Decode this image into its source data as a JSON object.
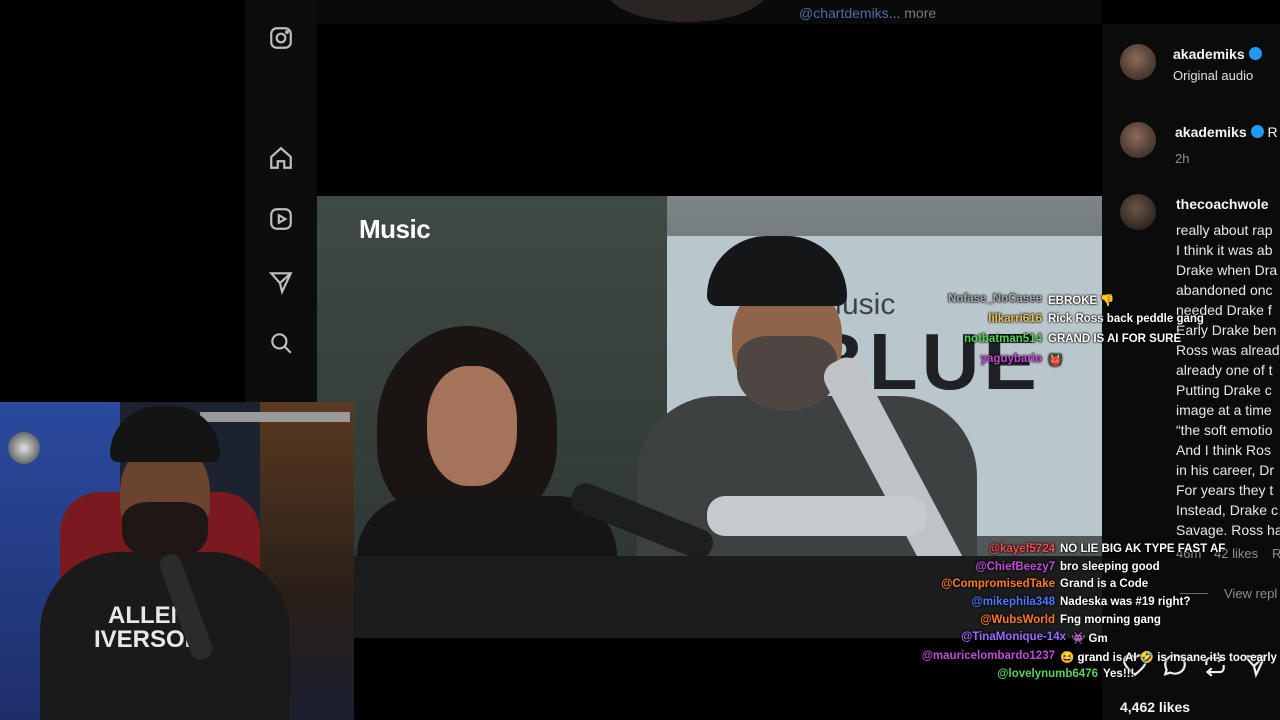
{
  "top_strip": {
    "caption_handle": "@chartdemiks",
    "caption_more": "... more"
  },
  "video": {
    "apple_music_logo": "Music",
    "sign_text": "BLUE",
    "sign_small": "Music"
  },
  "comments_panel": {
    "post_author": "akademiks",
    "post_audio": "Original audio",
    "caption_author": "akademiks",
    "caption_time": "2h",
    "caption_trailing": "R",
    "commenter": "thecoachwole",
    "comment_lines": [
      "really about rap",
      "I think it was ab",
      "Drake when Dra",
      "abandoned onc",
      "needed Drake f",
      "Early Drake ben",
      "Ross was alread",
      "already one of t",
      "Putting Drake c",
      "image at a time",
      "“the soft emotio",
      "And I think Ros",
      "in his career, Dr",
      "For years they t",
      "Instead, Drake c",
      "Savage. Ross ha"
    ],
    "comment_age": "46m",
    "comment_likes": "42 likes",
    "comment_reply": "R",
    "view_replies": "View repl",
    "likes_total": "4,462 likes"
  },
  "chat_overlay": {
    "colors": {
      "gray": "#a7a7a7",
      "green": "#58d35a",
      "yellow": "#e6c34a",
      "magenta": "#c24bd8",
      "red": "#ff4a4a",
      "orange": "#ff7a2a",
      "blue": "#4a7bff",
      "purple": "#9b6bff"
    },
    "messages_top": [
      {
        "user": "Nofase_NoCasee",
        "text": "EBROKE 👎"
      },
      {
        "user": "lilkarri616",
        "text": "Rick Ross back peddle gang"
      },
      {
        "user": "notbatman514",
        "text": "GRAND IS AI FOR SURE"
      },
      {
        "user": "yaguybario",
        "text": "👹"
      }
    ],
    "messages_bottom": [
      {
        "user": "@kayef5724",
        "text": "NO LIE BIG AK TYPE FAST AF"
      },
      {
        "user": "@ChiefBeezy7",
        "text": "bro sleeping good"
      },
      {
        "user": "@CompromisedTake",
        "text": "Grand is a Code"
      },
      {
        "user": "@mikephila348",
        "text": "Nadeska was #19 right?"
      },
      {
        "user": "@WubsWorld",
        "text": "Fng morning gang"
      },
      {
        "user": "@TinaMonique-14x",
        "text": "👾 Gm"
      },
      {
        "user": "@mauricelombardo1237",
        "text": "😆 grand is AI 🤣 is insane it’s too early"
      },
      {
        "user": "@lovelynumb6476",
        "text": "Yes!!!"
      }
    ]
  },
  "webcam": {
    "shirt_text": "ALLEN IVERSON"
  },
  "icons": [
    "instagram-icon",
    "home-icon",
    "reels-icon",
    "messages-icon",
    "search-icon",
    "like-icon",
    "comment-icon",
    "share-icon",
    "send-icon",
    "cursor-icon",
    "verified-badge-icon"
  ]
}
